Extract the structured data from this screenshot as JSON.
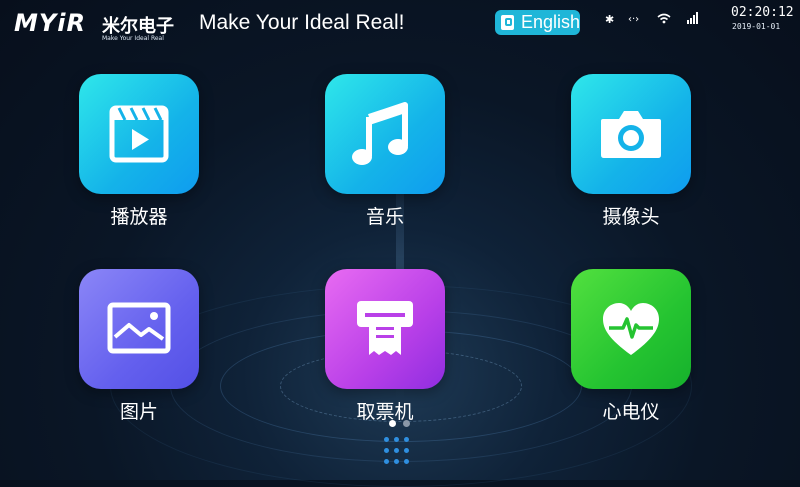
{
  "header": {
    "logo_text": "MYiR",
    "logo_cn": "米尔电子",
    "logo_sub": "Make Your Ideal Real",
    "slogan": "Make Your Ideal Real!",
    "language_button": "English",
    "status_icons": [
      "bluetooth-icon",
      "device-link-icon",
      "wifi-icon",
      "signal-icon"
    ],
    "time": "02:20:12",
    "date": "2019-01-01"
  },
  "apps": [
    {
      "label": "播放器",
      "icon": "video-player-icon",
      "color": "#14b3e9"
    },
    {
      "label": "音乐",
      "icon": "music-note-icon",
      "color": "#14b3e9"
    },
    {
      "label": "摄像头",
      "icon": "camera-icon",
      "color": "#14b3e9"
    },
    {
      "label": "图片",
      "icon": "picture-icon",
      "color": "#6460ee"
    },
    {
      "label": "取票机",
      "icon": "ticket-machine-icon",
      "color": "#b940e8"
    },
    {
      "label": "心电仪",
      "icon": "heart-ecg-icon",
      "color": "#25c431"
    }
  ],
  "pager": {
    "pages": 2,
    "current": 1
  },
  "colors": {
    "accent": "#1fb6d8",
    "background": "#0a1626"
  }
}
